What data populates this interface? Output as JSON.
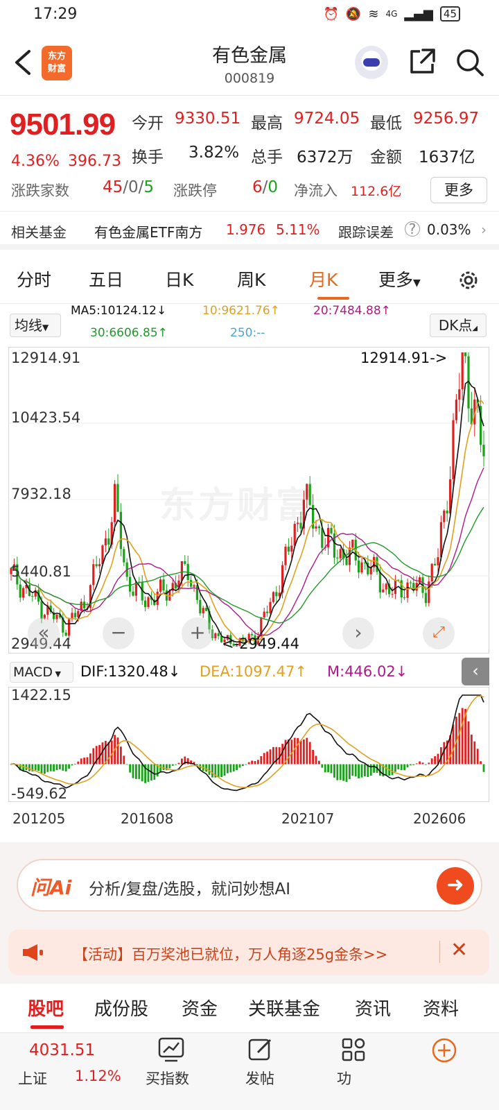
{
  "status_bar": {
    "time": "17:29",
    "network": "4G",
    "battery": "45"
  },
  "header": {
    "logo_line1": "东方",
    "logo_line2": "财富",
    "title": "有色金属",
    "code": "000819"
  },
  "quote": {
    "price": "9501.99",
    "change_pct": "4.36%",
    "change": "396.73",
    "open_label": "今开",
    "open": "9330.51",
    "high_label": "最高",
    "high": "9724.05",
    "low_label": "最低",
    "low": "9256.97",
    "turnover_label": "换手",
    "turnover": "3.82%",
    "volume_label": "总手",
    "volume": "6372万",
    "amount_label": "金额",
    "amount": "1637亿",
    "breadth_label": "涨跌家数",
    "breadth_up": "45",
    "breadth_flat": "0",
    "breadth_down": "5",
    "limit_label": "涨跌停",
    "limit_up": "6",
    "limit_down": "0",
    "netflow_label": "净流入",
    "netflow": "112.6亿",
    "more_button": "更多"
  },
  "fund_band": {
    "label": "相关基金",
    "fund_name": "有色金属ETF南方",
    "fund_price": "1.976",
    "fund_pct": "5.11%",
    "tracking_label": "跟踪误差",
    "tracking_value": "0.03%",
    "chevron": "›"
  },
  "period_tabs": [
    "分时",
    "五日",
    "日K",
    "周K",
    "月K",
    "更多"
  ],
  "ma": {
    "selector": "均线",
    "ma5": "MA5:10124.12↓",
    "ma10": "10:9621.76↑",
    "ma20": "20:7484.88↑",
    "ma30": "30:6606.85↑",
    "ma250": "250:--",
    "dk_button": "DK点"
  },
  "colors": {
    "up": "#e02020",
    "down": "#19a319",
    "ma5": "#111111",
    "ma10": "#e0a020",
    "ma20": "#b0188a",
    "ma30": "#1f9a2a",
    "accent": "#e8681c"
  },
  "kline": {
    "y_labels": [
      "12914.91",
      "10423.54",
      "7932.18",
      "5440.81",
      "2949.44"
    ],
    "max_marker": "12914.91->",
    "min_marker": "<-2949.44",
    "watermark": "东方财富"
  },
  "macd": {
    "selector": "MACD",
    "dif": "DIF:1320.48↓",
    "dea": "DEA:1097.47↑",
    "m": "M:446.02↓",
    "y_top": "1422.15",
    "y_bottom": "-549.62",
    "x_labels": [
      "201205",
      "201608",
      "202107",
      "202606"
    ]
  },
  "ai_bar": {
    "logo": "问Ai",
    "text": "分析/复盘/选股，就问妙想AI"
  },
  "promo": {
    "text": "【活动】百万奖池已就位，万人角逐25g金条>>"
  },
  "bottom_tabs": [
    "股吧",
    "成份股",
    "资金",
    "关联基金",
    "资讯",
    "资料"
  ],
  "footer": {
    "index_value": "4031.51",
    "index_name": "上证",
    "index_pct": "1.12%",
    "items": [
      "买指数",
      "发帖",
      "功"
    ]
  }
}
